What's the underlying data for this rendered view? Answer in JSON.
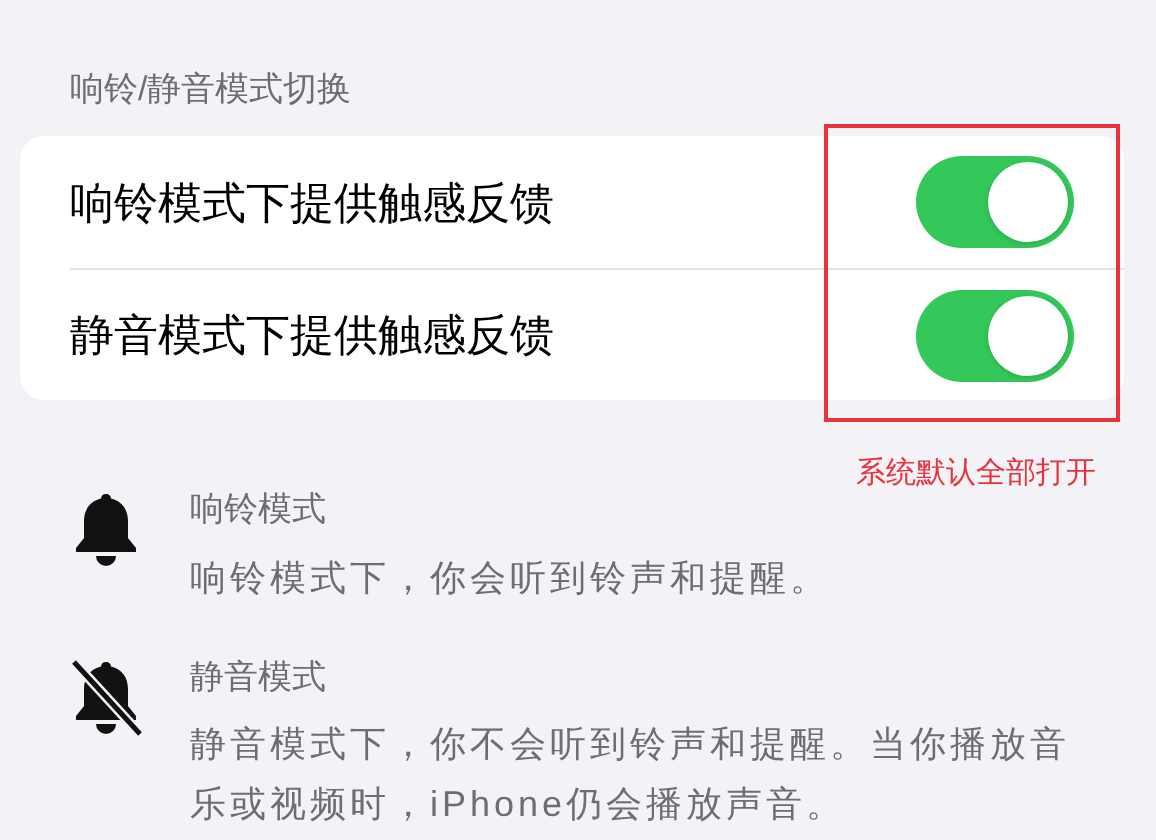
{
  "section_header": "响铃/静音模式切换",
  "toggles": [
    {
      "label": "响铃模式下提供触感反馈",
      "on": true
    },
    {
      "label": "静音模式下提供触感反馈",
      "on": true
    }
  ],
  "annotation": "系统默认全部打开",
  "modes": [
    {
      "kind": "ring",
      "title": "响铃模式",
      "description": "响铃模式下，你会听到铃声和提醒。"
    },
    {
      "kind": "silent",
      "title": "静音模式",
      "description": "静音模式下，你不会听到铃声和提醒。当你播放音乐或视频时，iPhone仍会播放声音。"
    }
  ]
}
